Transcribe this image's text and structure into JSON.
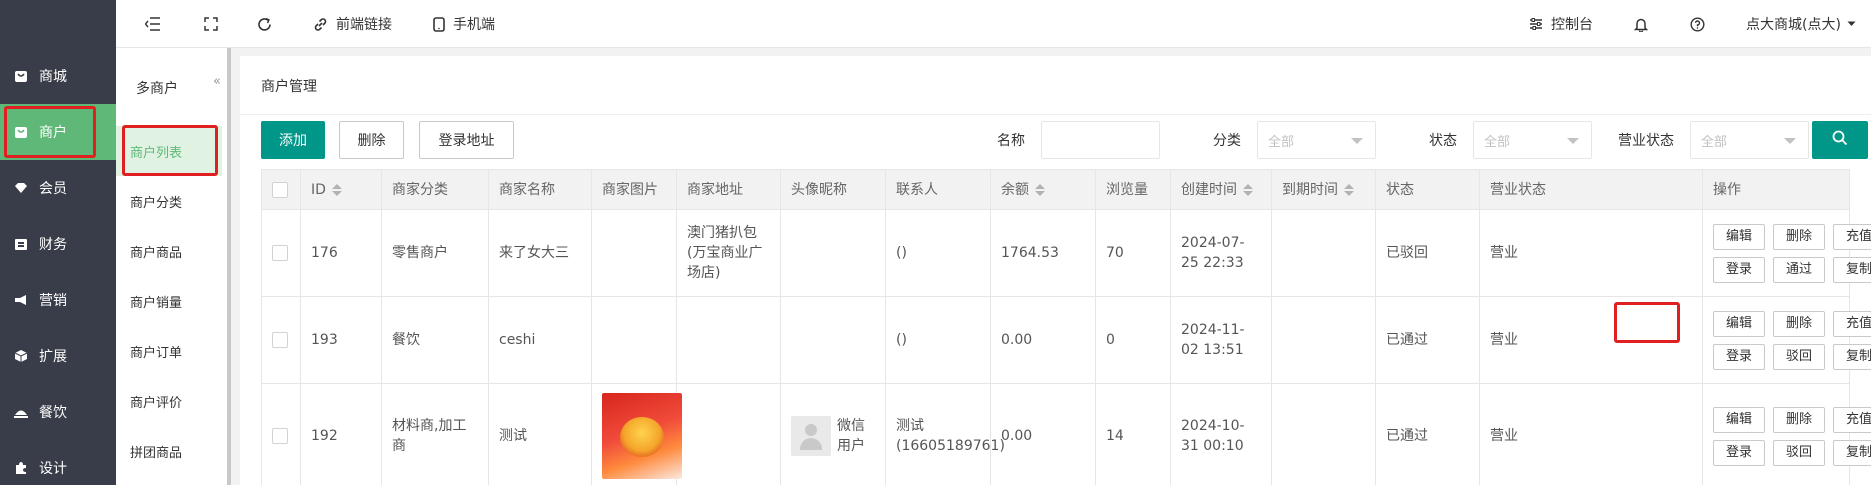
{
  "sidebar": {
    "items": [
      {
        "label": "商城",
        "icon": "store-icon"
      },
      {
        "label": "商户",
        "icon": "merchant-icon"
      },
      {
        "label": "会员",
        "icon": "member-icon"
      },
      {
        "label": "财务",
        "icon": "finance-icon"
      },
      {
        "label": "营销",
        "icon": "megaphone-icon"
      },
      {
        "label": "扩展",
        "icon": "box-icon"
      },
      {
        "label": "餐饮",
        "icon": "dish-icon"
      },
      {
        "label": "设计",
        "icon": "puzzle-icon"
      }
    ],
    "active_index": 1
  },
  "topbar": {
    "frontend_link": "前端链接",
    "mobile": "手机端",
    "console": "控制台",
    "user": "点大商城(点大)"
  },
  "submenu": {
    "title": "多商户",
    "collapse": "«",
    "items": [
      "商户列表",
      "商户分类",
      "商户商品",
      "商户销量",
      "商户订单",
      "商户评价",
      "拼团商品"
    ],
    "active_index": 0
  },
  "page": {
    "breadcrumb": "商户管理"
  },
  "toolbar": {
    "add": "添加",
    "delete": "删除",
    "login_url": "登录地址"
  },
  "filters": {
    "name_label": "名称",
    "name_value": "",
    "category_label": "分类",
    "category_value": "全部",
    "status_label": "状态",
    "status_value": "全部",
    "business_label": "营业状态",
    "business_value": "全部"
  },
  "table": {
    "headers": [
      "ID",
      "商家分类",
      "商家名称",
      "商家图片",
      "商家地址",
      "头像昵称",
      "联系人",
      "余额",
      "浏览量",
      "创建时间",
      "到期时间",
      "状态",
      "营业状态",
      "操作"
    ],
    "rows": [
      {
        "id": "176",
        "category": "零售商户",
        "name": "来了女大三",
        "address": "澳门猪扒包(万宝商业广场店)",
        "nickname": "",
        "contact": "()",
        "balance": "1764.53",
        "views": "70",
        "created": "2024-07-25 22:33",
        "expire": "",
        "status": "已驳回",
        "business": "营业",
        "actions": [
          "编辑",
          "删除",
          "充值",
          "登录",
          "通过",
          "复制数据"
        ]
      },
      {
        "id": "193",
        "category": "餐饮",
        "name": "ceshi",
        "address": "",
        "nickname": "",
        "contact": "()",
        "balance": "0.00",
        "views": "0",
        "created": "2024-11-02 13:51",
        "expire": "",
        "status": "已通过",
        "business": "营业",
        "actions": [
          "编辑",
          "删除",
          "充值",
          "登录",
          "驳回",
          "复制数据"
        ]
      },
      {
        "id": "192",
        "category": "材料商,加工商",
        "name": "测试",
        "address": "",
        "nickname": "微信用户",
        "contact": "测试(16605189761)",
        "balance": "0.00",
        "views": "14",
        "created": "2024-10-31 00:10",
        "expire": "",
        "status": "已通过",
        "business": "营业",
        "actions": [
          "编辑",
          "删除",
          "充值",
          "登录",
          "驳回",
          "复制数据"
        ]
      }
    ]
  },
  "colors": {
    "accent": "#009688",
    "sidebar_bg": "#393d49",
    "active_green": "#5fb878",
    "highlight_red": "#e02020"
  }
}
